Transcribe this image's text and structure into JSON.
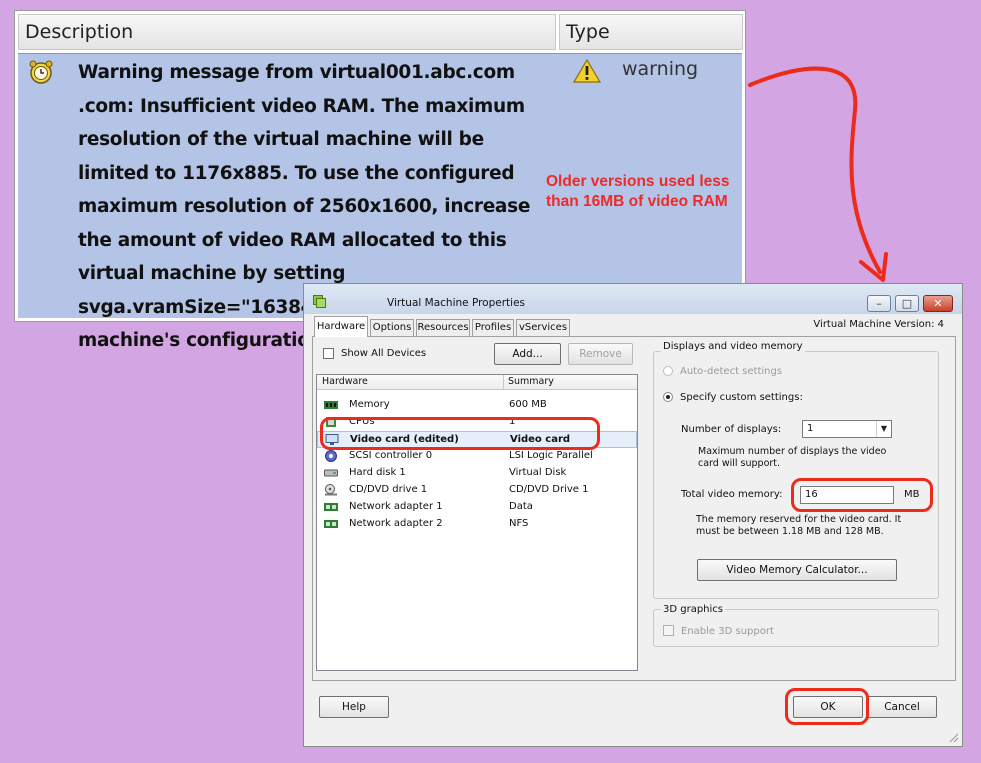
{
  "alert_panel": {
    "columns": {
      "description": "Description",
      "type": "Type"
    },
    "message": "Warning message from virtual001.abc.com .com: Insufficient video RAM. The maximum resolution of the virtual machine will be limited to 1176x885. To use the configured maximum resolution of 2560x1600, increase the amount of video RAM allocated to this virtual machine by setting svga.vramSize=\"16384000\" in the virtual machine's configuration",
    "type_text": "warning",
    "icons": {
      "alarm": "alarm-clock-icon",
      "warning": "warning-triangle-icon"
    }
  },
  "annotation": {
    "text": "Older versions used less than 16MB of video RAM",
    "color": "#ee2a2a"
  },
  "dialog": {
    "title": "Virtual Machine Properties",
    "vm_version": "Virtual Machine Version: 4",
    "tabs": [
      "Hardware",
      "Options",
      "Resources",
      "Profiles",
      "vServices"
    ],
    "active_tab": "Hardware",
    "show_all_devices": "Show All Devices",
    "add_button": "Add...",
    "remove_button": "Remove",
    "list": {
      "headers": {
        "hardware": "Hardware",
        "summary": "Summary"
      },
      "rows": [
        {
          "name": "Memory",
          "summary": "600 MB",
          "icon": "memory-icon"
        },
        {
          "name": "CPUs",
          "summary": "1",
          "icon": "cpu-icon"
        },
        {
          "name": "Video card  (edited)",
          "summary": "Video card",
          "icon": "monitor-icon",
          "selected": true
        },
        {
          "name": "SCSI controller 0",
          "summary": "LSI Logic Parallel",
          "icon": "scsi-controller-icon"
        },
        {
          "name": "Hard disk 1",
          "summary": "Virtual Disk",
          "icon": "hard-disk-icon"
        },
        {
          "name": "CD/DVD drive 1",
          "summary": "CD/DVD Drive 1",
          "icon": "cd-dvd-icon"
        },
        {
          "name": "Network adapter 1",
          "summary": "Data",
          "icon": "network-adapter-icon"
        },
        {
          "name": "Network adapter 2",
          "summary": "NFS",
          "icon": "network-adapter-icon"
        }
      ]
    },
    "displays_group": {
      "label": "Displays and video memory",
      "auto_detect": "Auto-detect settings",
      "custom": "Specify custom settings:",
      "num_displays_label": "Number of displays:",
      "num_displays_value": "1",
      "max_displays_note": "Maximum number of displays the video card will support.",
      "total_video_memory_label": "Total video memory:",
      "total_video_memory_value": "16",
      "unit": "MB",
      "reserved_note": "The memory reserved for the video card. It must be between 1.18 MB and 128 MB.",
      "calculator_button": "Video Memory Calculator..."
    },
    "graphics_group": {
      "label": "3D graphics",
      "enable_3d": "Enable 3D support"
    },
    "help_button": "Help",
    "ok_button": "OK",
    "cancel_button": "Cancel"
  },
  "highlight_color": "#ee2a1a"
}
